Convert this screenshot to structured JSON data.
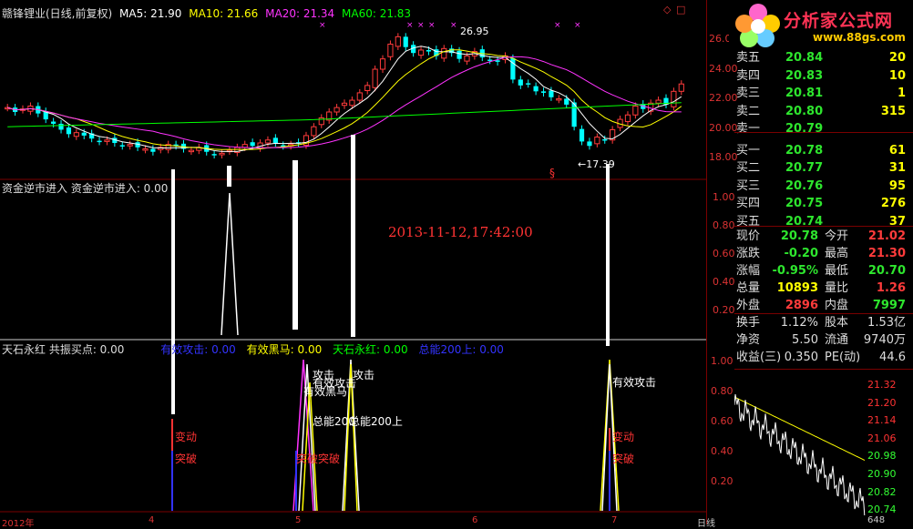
{
  "header": {
    "title": "赣锋锂业(日线,前复权)",
    "ma5": "MA5: 21.90",
    "ma10": "MA10: 21.66",
    "ma20": "MA20: 21.34",
    "ma60": "MA60: 21.83"
  },
  "price_axis": [
    "26.00",
    "24.00",
    "22.00",
    "20.00",
    "18.00"
  ],
  "mid_axis": [
    "1.00",
    "0.80",
    "0.60",
    "0.40",
    "0.20"
  ],
  "low_axis": [
    "1.00",
    "0.80",
    "0.60",
    "0.40",
    "0.20"
  ],
  "intraday_axis": [
    "21.32",
    "21.20",
    "21.14",
    "21.06",
    "20.98",
    "20.90",
    "20.82",
    "20.74"
  ],
  "annotations": {
    "high": "26.95",
    "low": "←17.39",
    "s_mark": "§",
    "timestamp": "2013-11-12,17:42:00"
  },
  "mid_panel": {
    "label": "资金逆市进入  资金逆市进入: 0.00"
  },
  "low_panel": {
    "label1": "天石永红  共振买点: 0.00",
    "label2": "有效攻击: 0.00",
    "label3": "有效黑马: 0.00",
    "label4": "天石永红: 0.00",
    "label5": "总能200上: 0.00",
    "signals": {
      "gongji1": "攻击",
      "gongji2": "攻击",
      "youxiao_gongji": "有效攻击",
      "youxiao_gongji2": "有效攻击",
      "youxiao_heima": "有效黑马",
      "zongneng1": "总能200",
      "zongneng2": "总能200上",
      "biandong1": "变动",
      "tupo1": "突破",
      "tupo2": "突破突破",
      "biandong2": "变动",
      "tupo3": "突破"
    }
  },
  "x_axis": {
    "y2012": "2012年",
    "m4": "4",
    "m5": "5",
    "m6": "6",
    "m7": "7",
    "period": "日线",
    "count": "648"
  },
  "logo": {
    "name": "分析家公式网",
    "url": "www.88gs.com"
  },
  "order_book": {
    "asks": [
      {
        "name": "卖五",
        "price": "20.84",
        "vol": "20"
      },
      {
        "name": "卖四",
        "price": "20.83",
        "vol": "10"
      },
      {
        "name": "卖三",
        "price": "20.81",
        "vol": "1"
      },
      {
        "name": "卖二",
        "price": "20.80",
        "vol": "315"
      },
      {
        "name": "卖一",
        "price": "20.79",
        "vol": ""
      }
    ],
    "bids": [
      {
        "name": "买一",
        "price": "20.78",
        "vol": "61"
      },
      {
        "name": "买二",
        "price": "20.77",
        "vol": "31"
      },
      {
        "name": "买三",
        "price": "20.76",
        "vol": "95"
      },
      {
        "name": "买四",
        "price": "20.75",
        "vol": "276"
      },
      {
        "name": "买五",
        "price": "20.74",
        "vol": "37"
      }
    ]
  },
  "quote": [
    {
      "l1": "现价",
      "v1": "20.78",
      "c1": "#2ee62e",
      "l2": "今开",
      "v2": "21.02",
      "c2": "#ff3b3b"
    },
    {
      "l1": "涨跌",
      "v1": "-0.20",
      "c1": "#2ee62e",
      "l2": "最高",
      "v2": "21.30",
      "c2": "#ff3b3b"
    },
    {
      "l1": "涨幅",
      "v1": "-0.95%",
      "c1": "#2ee62e",
      "l2": "最低",
      "v2": "20.70",
      "c2": "#2ee62e"
    },
    {
      "l1": "总量",
      "v1": "10893",
      "c1": "#ff0",
      "l2": "量比",
      "v2": "1.26",
      "c2": "#ff3b3b"
    },
    {
      "l1": "外盘",
      "v1": "2896",
      "c1": "#ff3b3b",
      "l2": "内盘",
      "v2": "7997",
      "c2": "#2ee62e"
    }
  ],
  "fundamentals": [
    {
      "l1": "换手",
      "v1": "1.12%",
      "l2": "股本",
      "v2": "1.53亿"
    },
    {
      "l1": "净资",
      "v1": "5.50",
      "l2": "流通",
      "v2": "9740万"
    },
    {
      "l1": "收益(三)",
      "v1": "0.350",
      "l2": "PE(动)",
      "v2": "44.6"
    }
  ],
  "colors": {
    "ma5": "#ffffff",
    "ma10": "#ffff00",
    "ma20": "#ff33ff",
    "ma60": "#00ff00",
    "up": "#ff3b3b",
    "down": "#00ffff",
    "grid": "#7a0000"
  }
}
